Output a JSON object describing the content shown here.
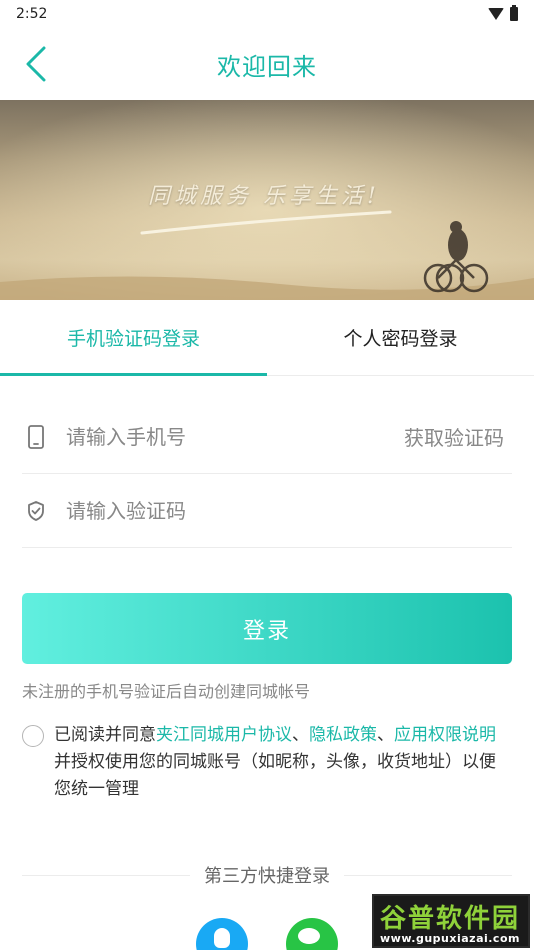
{
  "status_bar": {
    "time": "2:52",
    "icons": [
      "wifi-icon",
      "battery-icon"
    ]
  },
  "header": {
    "title": "欢迎回来",
    "back_icon": "chevron-left-icon"
  },
  "banner": {
    "caption": "同城服务 乐享生活!"
  },
  "tabs": [
    {
      "label": "手机验证码登录",
      "active": true
    },
    {
      "label": "个人密码登录",
      "active": false
    }
  ],
  "form": {
    "phone": {
      "placeholder": "请输入手机号",
      "value": "",
      "icon": "phone-icon"
    },
    "get_code_label": "获取验证码",
    "code": {
      "placeholder": "请输入验证码",
      "value": "",
      "icon": "shield-icon"
    },
    "login_label": "登录",
    "hint": "未注册的手机号验证后自动创建同城帐号"
  },
  "agreement": {
    "checked": false,
    "prefix": "已阅读并同意",
    "link_user_agreement": "夹江同城用户协议",
    "sep1": "、",
    "link_privacy": "隐私政策",
    "sep2": "、",
    "link_permissions": "应用权限说明",
    "suffix": "并授权使用您的同城账号（如昵称，头像，收货地址）以便您统一管理"
  },
  "third_party": {
    "title": "第三方快捷登录",
    "buttons": [
      {
        "icon": "qq-icon",
        "color": "#19a9f4"
      },
      {
        "icon": "wechat-icon",
        "color": "#28c445"
      }
    ]
  },
  "watermark": {
    "title": "谷普软件园",
    "url": "www.gupuxiazai.com"
  },
  "colors": {
    "accent": "#1bb8a8",
    "button_start": "#61efdf",
    "button_end": "#1cc2ae"
  }
}
